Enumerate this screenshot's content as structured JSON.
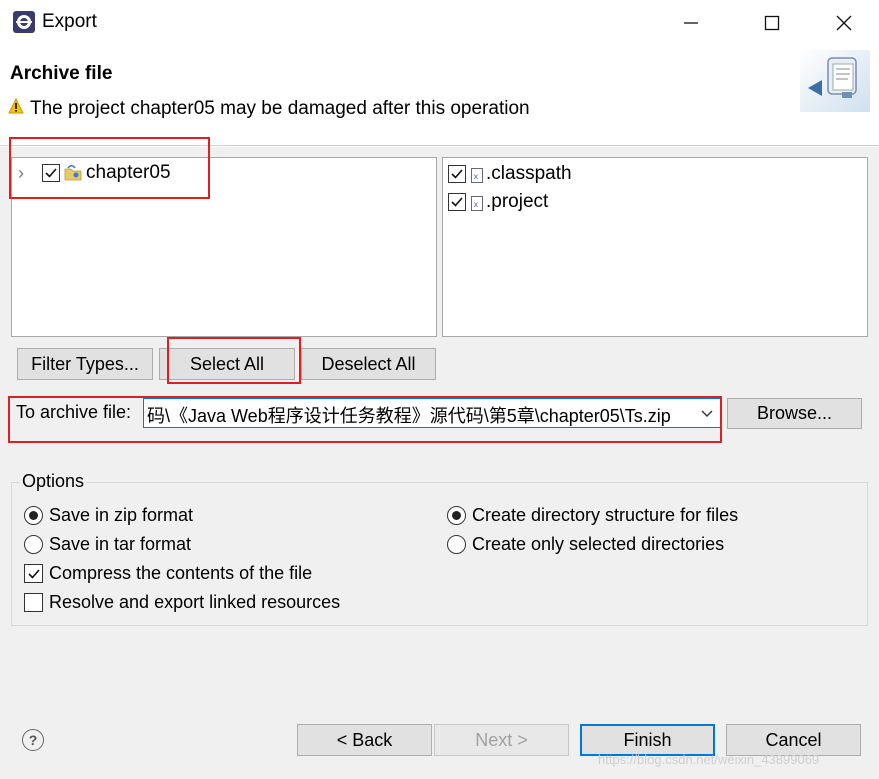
{
  "window": {
    "title": "Export",
    "minimize_glyph": "—",
    "maximize_glyph": "☐",
    "close_glyph": "✕"
  },
  "header": {
    "title": "Archive file",
    "message": "The project chapter05 may be damaged after this operation",
    "warning_icon": "warning-triangle-icon"
  },
  "tree": {
    "items": [
      {
        "label": "chapter05",
        "checked": true,
        "expand_glyph": "›"
      }
    ]
  },
  "files": {
    "items": [
      {
        "label": ".classpath",
        "checked": true
      },
      {
        "label": ".project",
        "checked": true
      }
    ]
  },
  "buttons": {
    "filter_types": "Filter Types...",
    "select_all": "Select All",
    "deselect_all": "Deselect All",
    "browse": "Browse...",
    "back": "< Back",
    "next": "Next >",
    "finish": "Finish",
    "cancel": "Cancel"
  },
  "archive": {
    "label": "To archive file:",
    "value": "码\\《Java Web程序设计任务教程》源代码\\第5章\\chapter05\\Ts.zip"
  },
  "options": {
    "legend": "Options",
    "save_zip": "Save in zip format",
    "save_tar": "Save in tar format",
    "compress": "Compress the contents of the file",
    "resolve_links": "Resolve and export linked resources",
    "create_dir_structure": "Create directory structure for files",
    "create_selected_dirs": "Create only selected directories",
    "state": {
      "format": "zip",
      "structure": "directory",
      "compress": true,
      "resolve_links": false
    }
  },
  "help_glyph": "?",
  "watermark": "https://blog.csdn.net/weixin_43899069",
  "colors": {
    "highlight": "#e02020",
    "focus": "#0078d7",
    "dialog_bg": "#f0f0f0"
  }
}
